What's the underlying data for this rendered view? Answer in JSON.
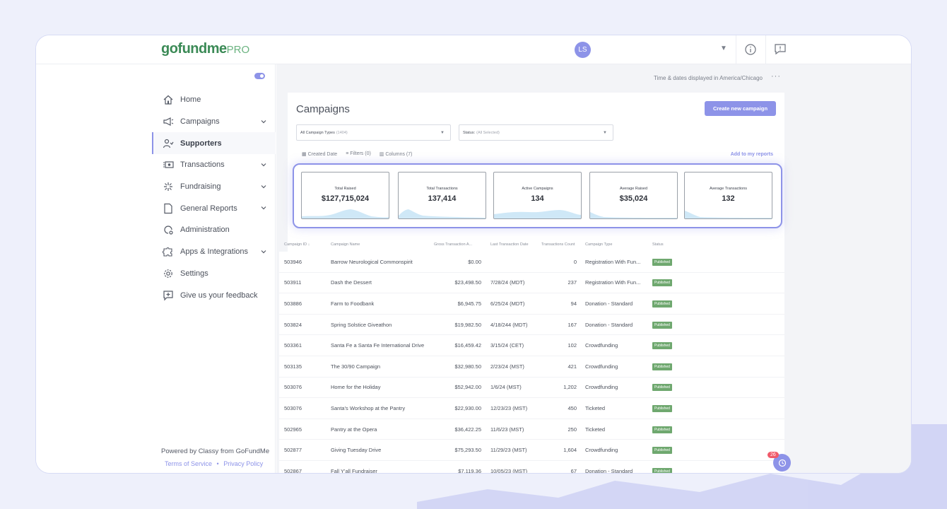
{
  "brand": {
    "logo_main": "gofundme",
    "logo_pro": "PRO",
    "accent": "#8d93e8",
    "green": "#3b8a56"
  },
  "topbar": {
    "avatar_initials": "LS",
    "icons": [
      "chevron-down-icon",
      "info-icon",
      "feedback-icon"
    ]
  },
  "sidebar": {
    "items": [
      {
        "label": "Home",
        "icon": "home-icon",
        "chevron": false,
        "active": false
      },
      {
        "label": "Campaigns",
        "icon": "megaphone-icon",
        "chevron": true,
        "active": false
      },
      {
        "label": "Supporters",
        "icon": "supporters-icon",
        "chevron": false,
        "active": true
      },
      {
        "label": "Transactions",
        "icon": "money-icon",
        "chevron": true,
        "active": false
      },
      {
        "label": "Fundraising",
        "icon": "sparkle-icon",
        "chevron": true,
        "active": false
      },
      {
        "label": "General Reports",
        "icon": "document-icon",
        "chevron": true,
        "active": false
      },
      {
        "label": "Administration",
        "icon": "admin-gear-icon",
        "chevron": false,
        "active": false
      },
      {
        "label": "Apps & Integrations",
        "icon": "puzzle-icon",
        "chevron": true,
        "active": false
      },
      {
        "label": "Settings",
        "icon": "settings-icon",
        "chevron": false,
        "active": false
      },
      {
        "label": "Give us your feedback",
        "icon": "feedback-plus-icon",
        "chevron": false,
        "active": false
      }
    ],
    "powered_by": "Powered by Classy from GoFundMe",
    "terms": "Terms of Service",
    "sep": "•",
    "privacy": "Privacy Policy"
  },
  "main": {
    "timezone": "Time & dates displayed in America/Chicago",
    "more": "···",
    "title": "Campaigns",
    "create_button": "Create new campaign",
    "campaign_types_label": "All Campaign Types",
    "campaign_types_count": "(1404)",
    "status_label": "Status",
    "status_hint": "(All Selected)",
    "filters": [
      "Created Date",
      "Filters (0)",
      "Columns (7)"
    ],
    "add_report": "Add to my reports",
    "kpis": [
      {
        "label": "Total Raised",
        "value": "$127,715,024"
      },
      {
        "label": "Total Transactions",
        "value": "137,414"
      },
      {
        "label": "Active Campaigns",
        "value": "134"
      },
      {
        "label": "Average Raised",
        "value": "$35,024"
      },
      {
        "label": "Average Transactions",
        "value": "132"
      }
    ],
    "columns": [
      "Campaign ID",
      "Campaign Name",
      "Gross Transaction A...",
      "Last Transaction Date",
      "Transactions Count",
      "Campaign Type",
      "Status"
    ],
    "rows": [
      [
        "503946",
        "Barrow Neurological Commonspirit",
        "$0.00",
        "",
        "0",
        "Registration With Fun...",
        "Published"
      ],
      [
        "503911",
        "Dash the Dessert",
        "$23,498.50",
        "7/28/24 (MDT)",
        "237",
        "Registration With Fun...",
        "Published"
      ],
      [
        "503886",
        "Farm to Foodbank",
        "$6,945.75",
        "6/25/24 (MDT)",
        "94",
        "Donation - Standard",
        "Published"
      ],
      [
        "503824",
        "Spring Solstice Giveathon",
        "$19,982.50",
        "4/18/244 (MDT)",
        "167",
        "Donation - Standard",
        "Published"
      ],
      [
        "503361",
        "Santa Fe a Santa Fe International Drive",
        "$16,459.42",
        "3/15/24 (CET)",
        "102",
        "Crowdfunding",
        "Published"
      ],
      [
        "503135",
        "The 30/90 Campaign",
        "$32,980.50",
        "2/23/24 (MST)",
        "421",
        "Crowdfunding",
        "Published"
      ],
      [
        "503076",
        "Home for the Holiday",
        "$52,942.00",
        "1/6/24 (MST)",
        "1,202",
        "Crowdfunding",
        "Published"
      ],
      [
        "503076",
        "Santa's Workshop at the Pantry",
        "$22,930.00",
        "12/23/23 (MST)",
        "450",
        "Ticketed",
        "Published"
      ],
      [
        "502965",
        "Pantry at the Opera",
        "$36,422.25",
        "11/6/23 (MST)",
        "250",
        "Ticketed",
        "Published"
      ],
      [
        "502877",
        "Giving Tuesday Drive",
        "$75,293.50",
        "11/29/23 (MST)",
        "1,604",
        "Crowdfunding",
        "Published"
      ],
      [
        "502867",
        "Fall Y'all Fundraiser",
        "$7,119.36",
        "10/05/23 (MST)",
        "67",
        "Donation - Standard",
        "Published"
      ]
    ],
    "notification_count": "26"
  }
}
